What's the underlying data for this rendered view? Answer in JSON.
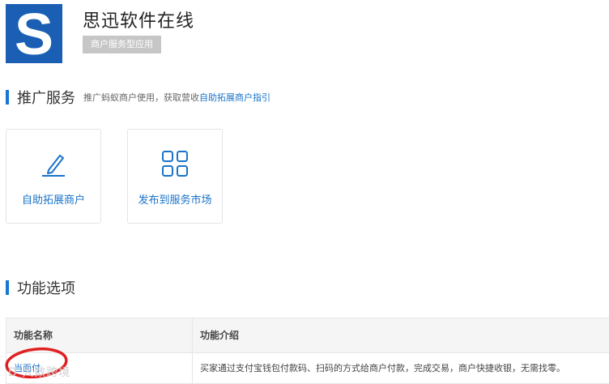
{
  "app": {
    "logo_letter": "S",
    "title": "思迅软件在线",
    "badge": "商户服务型应用"
  },
  "promo": {
    "title": "推广服务",
    "desc_prefix": "推广蚂蚁商户使用，获取营收",
    "desc_link": "自助拓展商户指引"
  },
  "cards": [
    {
      "label": "自助拓展商户",
      "icon": "pencil-icon"
    },
    {
      "label": "发布到服务市场",
      "icon": "grid-icon"
    }
  ],
  "features": {
    "title": "功能选项",
    "columns": [
      "功能名称",
      "功能介绍"
    ],
    "rows": [
      {
        "name": "当面付",
        "intro": "买家通过支付宝钱包付款码、扫码的方式给商户付款，完成交易，商户快捷收银，无需找零。"
      }
    ]
  },
  "watermark": "D 大数跨境",
  "colors": {
    "accent": "#1677d2",
    "logo": "#1a5fb4",
    "annotation": "#e02020"
  }
}
